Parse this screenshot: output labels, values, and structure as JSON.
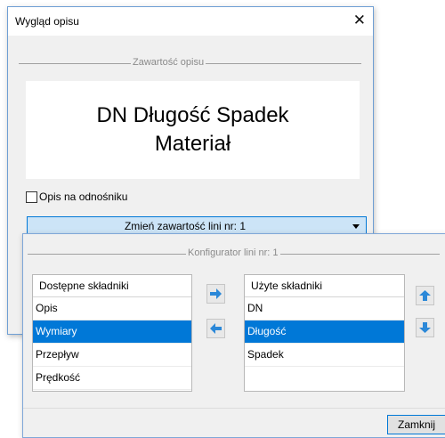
{
  "main_dialog": {
    "title": "Wygląd opisu",
    "close_icon": "close-icon",
    "group_caption": "Zawartość opisu",
    "preview_lines": [
      "DN Długość Spadek",
      "Materiał"
    ],
    "checkbox_label": "Opis na odnośniku",
    "checkbox_checked": false,
    "line_select_value": "Zmień zawartość lini nr: 1"
  },
  "configurator": {
    "group_caption": "Konfigurator lini nr: 1",
    "available": {
      "header": "Dostępne składniki",
      "items": [
        "Opis",
        "Wymiary",
        "Przepływ",
        "Prędkość"
      ],
      "selected_index": 1
    },
    "used": {
      "header": "Użyte składniki",
      "items": [
        "DN",
        "Długość",
        "Spadek"
      ],
      "selected_index": 1
    },
    "icons": {
      "add": "arrow-right-icon",
      "remove": "arrow-left-icon",
      "up": "arrow-up-icon",
      "down": "arrow-down-icon"
    },
    "close_label": "Zamknij"
  },
  "colors": {
    "selection": "#0078d7",
    "combo_bg": "#cce4f7",
    "arrow_blue": "#2b88d8"
  }
}
